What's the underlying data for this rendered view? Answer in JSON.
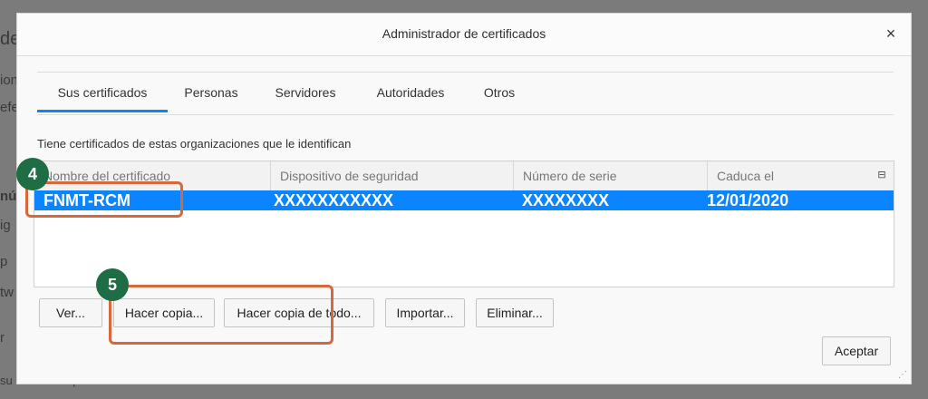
{
  "background": {
    "fragments": [
      "de",
      "ion",
      "efe",
      "nú",
      "ig",
      "p",
      "tw",
      "r",
      "su certificado personal"
    ]
  },
  "dialog": {
    "title": "Administrador de certificados",
    "close_glyph": "×"
  },
  "tabs": [
    {
      "label": "Sus certificados",
      "active": true
    },
    {
      "label": "Personas",
      "active": false
    },
    {
      "label": "Servidores",
      "active": false
    },
    {
      "label": "Autoridades",
      "active": false
    },
    {
      "label": "Otros",
      "active": false
    }
  ],
  "description": "Tiene certificados de estas organizaciones que le identifican",
  "table": {
    "columns": [
      "Nombre del certificado",
      "Dispositivo de seguridad",
      "Número de serie",
      "Caduca el"
    ],
    "column_picker_icon": "column-picker-icon",
    "rows": [
      {
        "name": "FNMT-RCM",
        "device": "XXXXXXXXXXX",
        "serial": "XXXXXXXX",
        "expires": "12/01/2020",
        "selected": true
      }
    ]
  },
  "buttons": {
    "view": "Ver...",
    "backup": "Hacer copia...",
    "backup_all": "Hacer copia de todo...",
    "import": "Importar...",
    "delete": "Eliminar...",
    "accept": "Aceptar"
  },
  "annotations": {
    "badge_4": "4",
    "badge_5": "5"
  },
  "colors": {
    "accent": "#0a84ff",
    "highlight": "#d7673c",
    "badge": "#1f6d44"
  }
}
